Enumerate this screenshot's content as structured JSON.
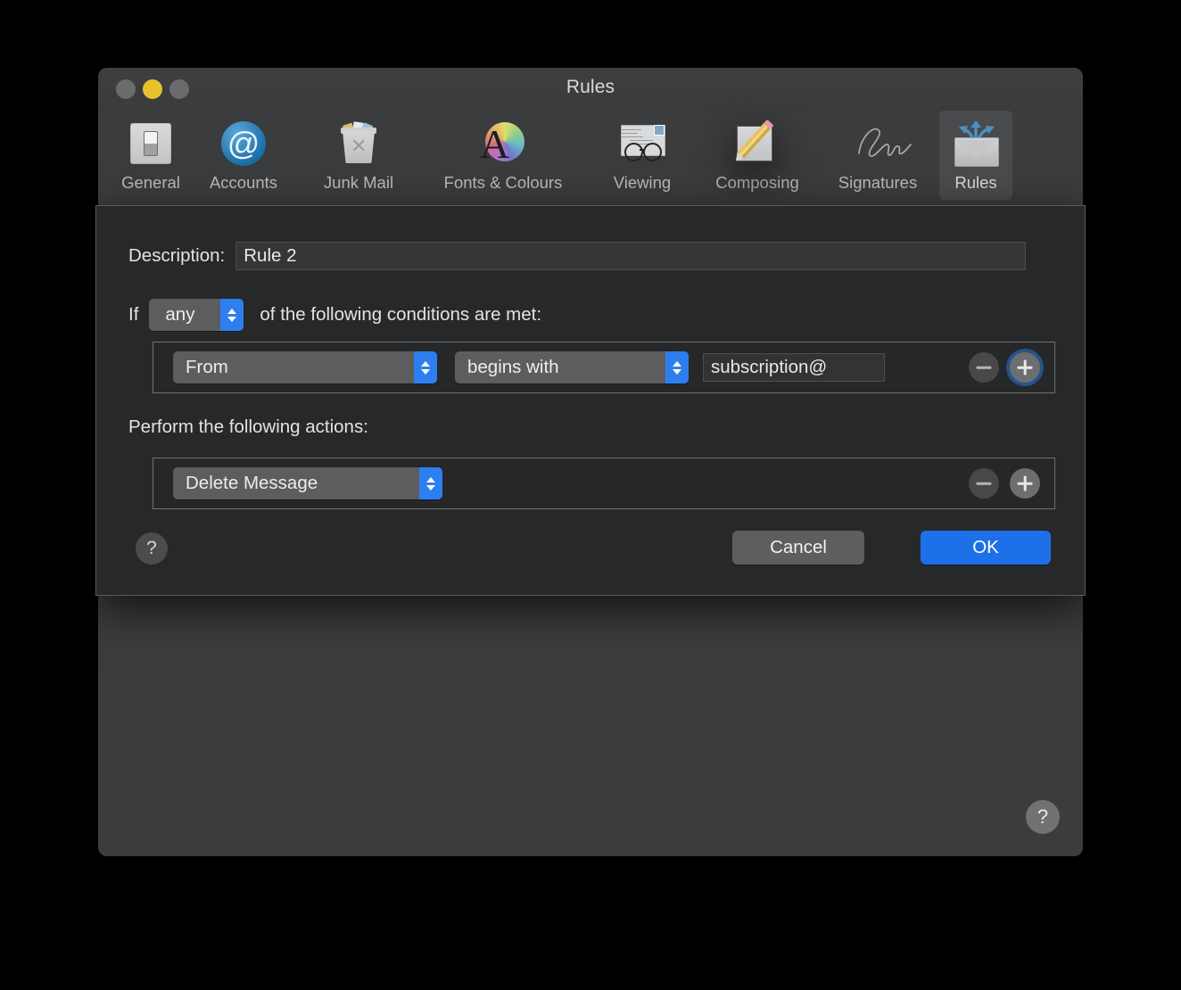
{
  "window": {
    "title": "Rules",
    "traffic_lights": [
      "close-button",
      "minimize-button",
      "zoom-button"
    ]
  },
  "toolbar": {
    "items": [
      {
        "label": "General",
        "icon": "general-switch-icon",
        "selected": false
      },
      {
        "label": "Accounts",
        "icon": "at-sign-icon",
        "selected": false
      },
      {
        "label": "Junk Mail",
        "icon": "trash-can-icon",
        "selected": false
      },
      {
        "label": "Fonts & Colours",
        "icon": "font-colour-icon",
        "selected": false
      },
      {
        "label": "Viewing",
        "icon": "envelope-glasses-icon",
        "selected": false
      },
      {
        "label": "Composing",
        "icon": "pencil-paper-icon",
        "selected": false
      },
      {
        "label": "Signatures",
        "icon": "signature-icon",
        "selected": false
      },
      {
        "label": "Rules",
        "icon": "rules-envelope-icon",
        "selected": true
      }
    ]
  },
  "sheet": {
    "description_label": "Description:",
    "description_value": "Rule 2",
    "description_placeholder": "Description",
    "if_label": "If",
    "match_select": "any",
    "conditions_tail": "of the following conditions are met:",
    "condition": {
      "header_select": "From",
      "operator_select": "begins with",
      "value": "subscription@",
      "value_placeholder": "",
      "remove_label": "−",
      "add_label": "+"
    },
    "actions_label": "Perform the following actions:",
    "action": {
      "action_select": "Delete Message",
      "remove_label": "−",
      "add_label": "+"
    },
    "help_label": "?",
    "cancel_label": "Cancel",
    "ok_label": "OK"
  },
  "prefs_body": {
    "help_label": "?"
  },
  "colors": {
    "accent_blue": "#1d70e8",
    "popup_chevron_blue": "#2d7ff0",
    "window_bg": "#3b3c3e",
    "sheet_bg": "#272829",
    "minimize_yellow": "#e8c12e"
  }
}
